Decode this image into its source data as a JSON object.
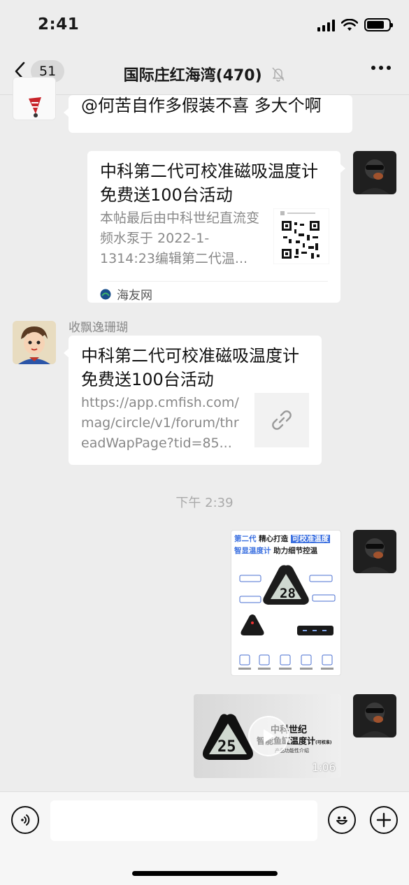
{
  "status_bar": {
    "time": "2:41"
  },
  "nav": {
    "back_count": "51",
    "title": "国际庄红海湾(470)"
  },
  "messages": {
    "m1": {
      "text": "@何苦自作多假装不喜 多大个啊"
    },
    "m2": {
      "card_title": "中科第二代可校准磁吸温度计免费送100台活动",
      "card_desc": "本帖最后由中科世纪直流变频水泵于 2022-1-1314:23编辑第二代温...",
      "source": "海友网"
    },
    "m3": {
      "sender": "收飘逸珊瑚",
      "card_title": "中科第二代可校准磁吸温度计免费送100台活动",
      "card_url": "https://app.cmfish.com/mag/circle/v1/forum/threadWapPage?tid=85..."
    },
    "time_divider": "下午 2:39",
    "m4": {
      "header_line1_a": "第二代",
      "header_line1_b": "精心打造",
      "header_line1_c": "可校准温度",
      "header_line2_a": "智显温度计",
      "header_line2_b": "助力细节控温",
      "display_value": "28",
      "feature_labels": [
        "",
        "",
        "",
        "",
        ""
      ]
    },
    "m5": {
      "title": "中科世纪",
      "subtitle": "智能鱼缸温度计",
      "note": "(可校准)",
      "caption": "产品功能性介绍",
      "display_value": "25",
      "duration": "1:06"
    }
  },
  "colors": {
    "background": "#ededed",
    "bubble": "#ffffff",
    "accent_blue": "#2f5fd6"
  }
}
